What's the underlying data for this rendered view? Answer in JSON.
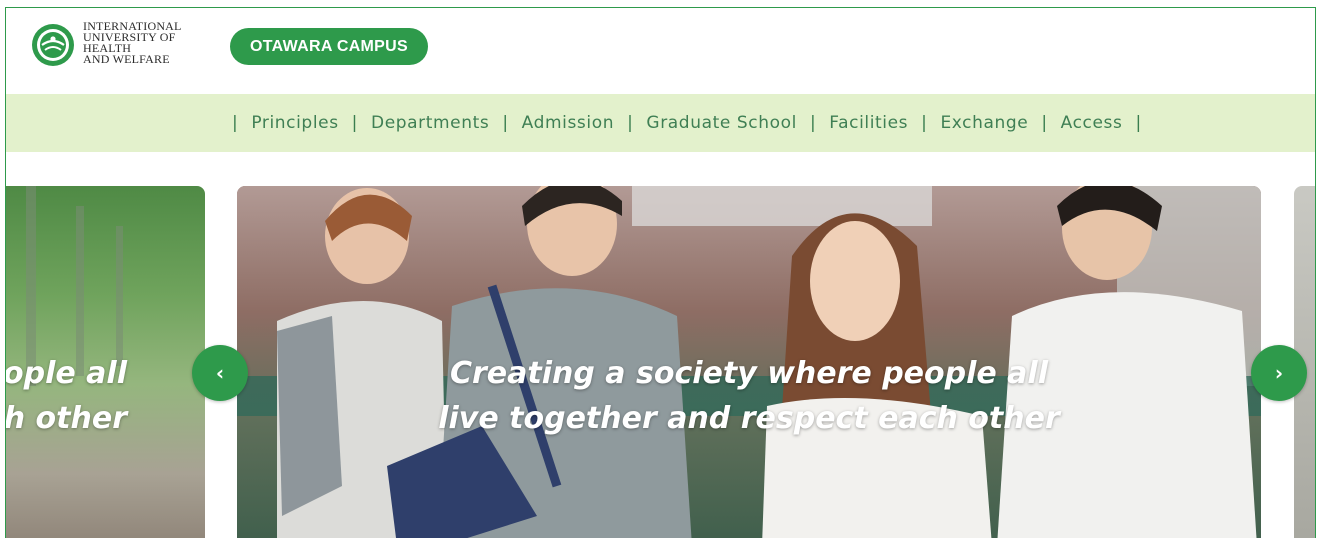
{
  "header": {
    "logo_lines": [
      "INTERNATIONAL",
      "UNIVERSITY OF",
      "HEALTH",
      "AND WELFARE"
    ],
    "campus_label": "OTAWARA CAMPUS"
  },
  "nav": {
    "separator": "|",
    "items": [
      "Principles",
      "Departments",
      "Admission",
      "Graduate School",
      "Facilities",
      "Exchange",
      "Access"
    ]
  },
  "carousel": {
    "prev_caption_lines": [
      "ople all",
      "h other"
    ],
    "main_caption_lines": [
      "Creating a society where people all",
      "live together and respect each other"
    ],
    "prev_arrow": "‹",
    "next_arrow": "›"
  },
  "colors": {
    "brand_green": "#2e9a4b",
    "nav_bg": "#e3f1cc",
    "nav_text": "#3f7f54"
  }
}
